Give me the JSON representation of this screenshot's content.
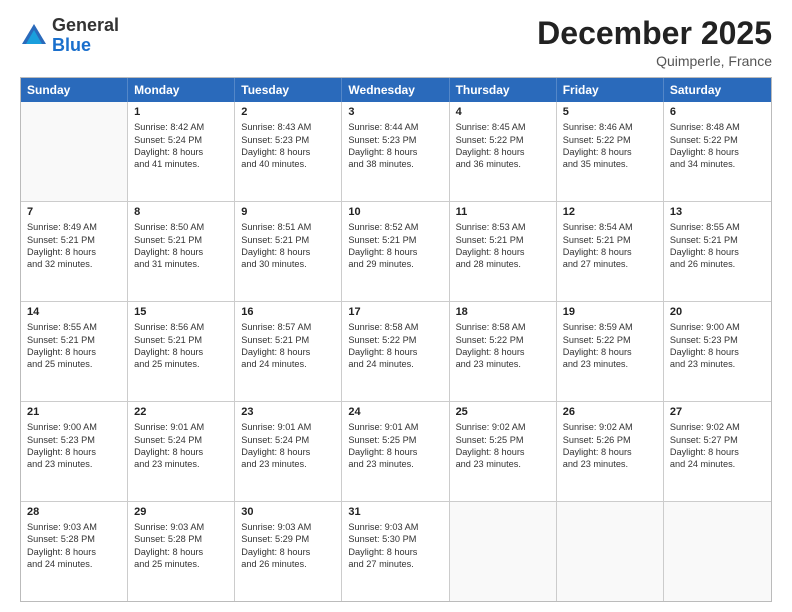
{
  "logo": {
    "general": "General",
    "blue": "Blue"
  },
  "header": {
    "month": "December 2025",
    "location": "Quimperle, France"
  },
  "weekdays": [
    "Sunday",
    "Monday",
    "Tuesday",
    "Wednesday",
    "Thursday",
    "Friday",
    "Saturday"
  ],
  "weeks": [
    [
      {
        "day": "",
        "lines": []
      },
      {
        "day": "1",
        "lines": [
          "Sunrise: 8:42 AM",
          "Sunset: 5:24 PM",
          "Daylight: 8 hours",
          "and 41 minutes."
        ]
      },
      {
        "day": "2",
        "lines": [
          "Sunrise: 8:43 AM",
          "Sunset: 5:23 PM",
          "Daylight: 8 hours",
          "and 40 minutes."
        ]
      },
      {
        "day": "3",
        "lines": [
          "Sunrise: 8:44 AM",
          "Sunset: 5:23 PM",
          "Daylight: 8 hours",
          "and 38 minutes."
        ]
      },
      {
        "day": "4",
        "lines": [
          "Sunrise: 8:45 AM",
          "Sunset: 5:22 PM",
          "Daylight: 8 hours",
          "and 36 minutes."
        ]
      },
      {
        "day": "5",
        "lines": [
          "Sunrise: 8:46 AM",
          "Sunset: 5:22 PM",
          "Daylight: 8 hours",
          "and 35 minutes."
        ]
      },
      {
        "day": "6",
        "lines": [
          "Sunrise: 8:48 AM",
          "Sunset: 5:22 PM",
          "Daylight: 8 hours",
          "and 34 minutes."
        ]
      }
    ],
    [
      {
        "day": "7",
        "lines": [
          "Sunrise: 8:49 AM",
          "Sunset: 5:21 PM",
          "Daylight: 8 hours",
          "and 32 minutes."
        ]
      },
      {
        "day": "8",
        "lines": [
          "Sunrise: 8:50 AM",
          "Sunset: 5:21 PM",
          "Daylight: 8 hours",
          "and 31 minutes."
        ]
      },
      {
        "day": "9",
        "lines": [
          "Sunrise: 8:51 AM",
          "Sunset: 5:21 PM",
          "Daylight: 8 hours",
          "and 30 minutes."
        ]
      },
      {
        "day": "10",
        "lines": [
          "Sunrise: 8:52 AM",
          "Sunset: 5:21 PM",
          "Daylight: 8 hours",
          "and 29 minutes."
        ]
      },
      {
        "day": "11",
        "lines": [
          "Sunrise: 8:53 AM",
          "Sunset: 5:21 PM",
          "Daylight: 8 hours",
          "and 28 minutes."
        ]
      },
      {
        "day": "12",
        "lines": [
          "Sunrise: 8:54 AM",
          "Sunset: 5:21 PM",
          "Daylight: 8 hours",
          "and 27 minutes."
        ]
      },
      {
        "day": "13",
        "lines": [
          "Sunrise: 8:55 AM",
          "Sunset: 5:21 PM",
          "Daylight: 8 hours",
          "and 26 minutes."
        ]
      }
    ],
    [
      {
        "day": "14",
        "lines": [
          "Sunrise: 8:55 AM",
          "Sunset: 5:21 PM",
          "Daylight: 8 hours",
          "and 25 minutes."
        ]
      },
      {
        "day": "15",
        "lines": [
          "Sunrise: 8:56 AM",
          "Sunset: 5:21 PM",
          "Daylight: 8 hours",
          "and 25 minutes."
        ]
      },
      {
        "day": "16",
        "lines": [
          "Sunrise: 8:57 AM",
          "Sunset: 5:21 PM",
          "Daylight: 8 hours",
          "and 24 minutes."
        ]
      },
      {
        "day": "17",
        "lines": [
          "Sunrise: 8:58 AM",
          "Sunset: 5:22 PM",
          "Daylight: 8 hours",
          "and 24 minutes."
        ]
      },
      {
        "day": "18",
        "lines": [
          "Sunrise: 8:58 AM",
          "Sunset: 5:22 PM",
          "Daylight: 8 hours",
          "and 23 minutes."
        ]
      },
      {
        "day": "19",
        "lines": [
          "Sunrise: 8:59 AM",
          "Sunset: 5:22 PM",
          "Daylight: 8 hours",
          "and 23 minutes."
        ]
      },
      {
        "day": "20",
        "lines": [
          "Sunrise: 9:00 AM",
          "Sunset: 5:23 PM",
          "Daylight: 8 hours",
          "and 23 minutes."
        ]
      }
    ],
    [
      {
        "day": "21",
        "lines": [
          "Sunrise: 9:00 AM",
          "Sunset: 5:23 PM",
          "Daylight: 8 hours",
          "and 23 minutes."
        ]
      },
      {
        "day": "22",
        "lines": [
          "Sunrise: 9:01 AM",
          "Sunset: 5:24 PM",
          "Daylight: 8 hours",
          "and 23 minutes."
        ]
      },
      {
        "day": "23",
        "lines": [
          "Sunrise: 9:01 AM",
          "Sunset: 5:24 PM",
          "Daylight: 8 hours",
          "and 23 minutes."
        ]
      },
      {
        "day": "24",
        "lines": [
          "Sunrise: 9:01 AM",
          "Sunset: 5:25 PM",
          "Daylight: 8 hours",
          "and 23 minutes."
        ]
      },
      {
        "day": "25",
        "lines": [
          "Sunrise: 9:02 AM",
          "Sunset: 5:25 PM",
          "Daylight: 8 hours",
          "and 23 minutes."
        ]
      },
      {
        "day": "26",
        "lines": [
          "Sunrise: 9:02 AM",
          "Sunset: 5:26 PM",
          "Daylight: 8 hours",
          "and 23 minutes."
        ]
      },
      {
        "day": "27",
        "lines": [
          "Sunrise: 9:02 AM",
          "Sunset: 5:27 PM",
          "Daylight: 8 hours",
          "and 24 minutes."
        ]
      }
    ],
    [
      {
        "day": "28",
        "lines": [
          "Sunrise: 9:03 AM",
          "Sunset: 5:28 PM",
          "Daylight: 8 hours",
          "and 24 minutes."
        ]
      },
      {
        "day": "29",
        "lines": [
          "Sunrise: 9:03 AM",
          "Sunset: 5:28 PM",
          "Daylight: 8 hours",
          "and 25 minutes."
        ]
      },
      {
        "day": "30",
        "lines": [
          "Sunrise: 9:03 AM",
          "Sunset: 5:29 PM",
          "Daylight: 8 hours",
          "and 26 minutes."
        ]
      },
      {
        "day": "31",
        "lines": [
          "Sunrise: 9:03 AM",
          "Sunset: 5:30 PM",
          "Daylight: 8 hours",
          "and 27 minutes."
        ]
      },
      {
        "day": "",
        "lines": []
      },
      {
        "day": "",
        "lines": []
      },
      {
        "day": "",
        "lines": []
      }
    ]
  ]
}
